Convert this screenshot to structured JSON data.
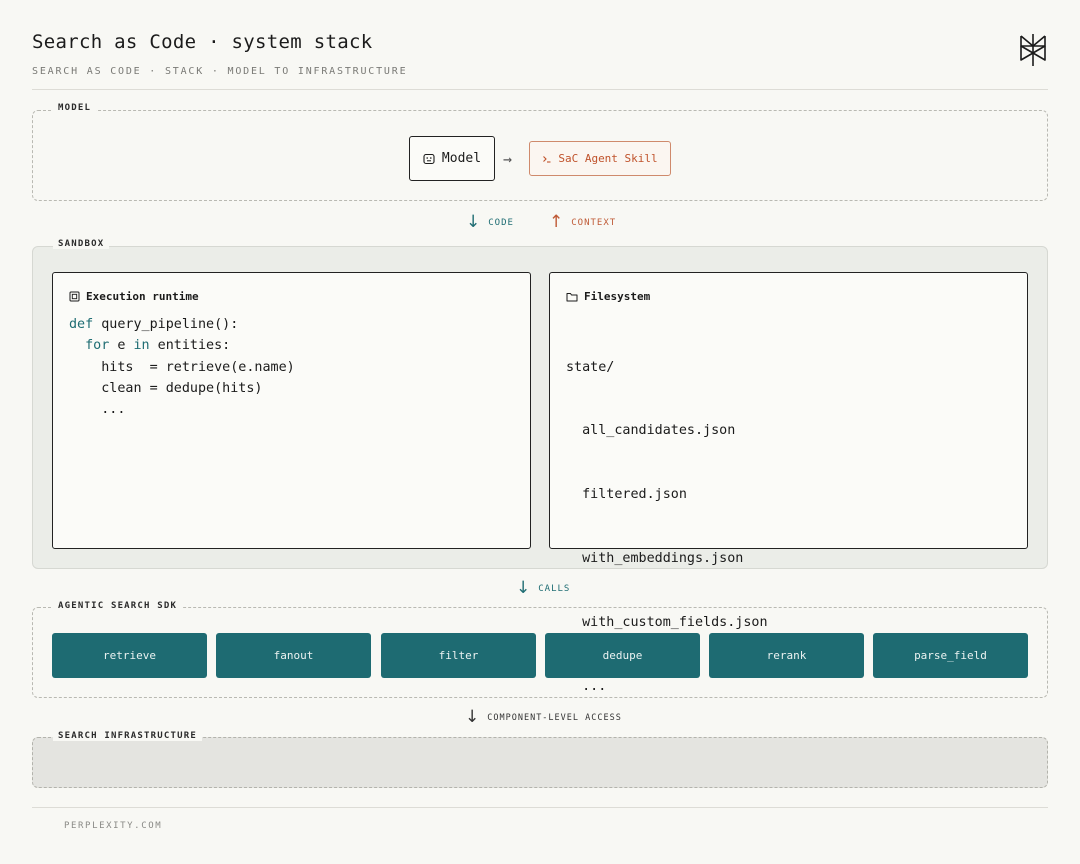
{
  "header": {
    "title": "Search as Code · system stack",
    "subtitle": "SEARCH AS CODE · STACK · MODEL TO INFRASTRUCTURE"
  },
  "model_section": {
    "label": "MODEL",
    "model_box": "Model",
    "arrow": "→",
    "skill_box": "SaC Agent Skill"
  },
  "flows": {
    "code": "CODE",
    "context": "CONTEXT",
    "calls": "CALLS",
    "component_access": "COMPONENT-LEVEL ACCESS"
  },
  "sandbox": {
    "label": "SANDBOX",
    "runtime": {
      "title": "Execution runtime",
      "code_lines": [
        [
          {
            "t": "def",
            "k": true
          },
          {
            "t": " query_pipeline():",
            "k": false
          }
        ],
        [
          {
            "t": "  ",
            "k": false
          },
          {
            "t": "for",
            "k": true
          },
          {
            "t": " e ",
            "k": false
          },
          {
            "t": "in",
            "k": true
          },
          {
            "t": " entities:",
            "k": false
          }
        ],
        [
          {
            "t": "    hits  = retrieve(e.name)",
            "k": false
          }
        ],
        [
          {
            "t": "    clean = dedupe(hits)",
            "k": false
          }
        ],
        [
          {
            "t": "    ...",
            "k": false
          }
        ]
      ]
    },
    "filesystem": {
      "title": "Filesystem",
      "lines": [
        "state/",
        "  all_candidates.json",
        "  filtered.json",
        "  with_embeddings.json",
        "  with_custom_fields.json",
        "  ..."
      ]
    }
  },
  "sdk": {
    "label": "AGENTIC SEARCH SDK",
    "buttons": [
      "retrieve",
      "fanout",
      "filter",
      "dedupe",
      "rerank",
      "parse_field"
    ]
  },
  "infrastructure": {
    "label": "SEARCH INFRASTRUCTURE"
  },
  "footer": {
    "text": "PERPLEXITY.COM"
  },
  "colors": {
    "accent_teal": "#1e6b72",
    "accent_orange": "#c0532c",
    "background": "#f8f8f4"
  },
  "icons": {
    "logo": "perplexity-logo",
    "model": "robot-face-icon",
    "skill": "terminal-prompt-icon",
    "runtime": "cpu-chip-icon",
    "filesystem": "folder-icon"
  }
}
